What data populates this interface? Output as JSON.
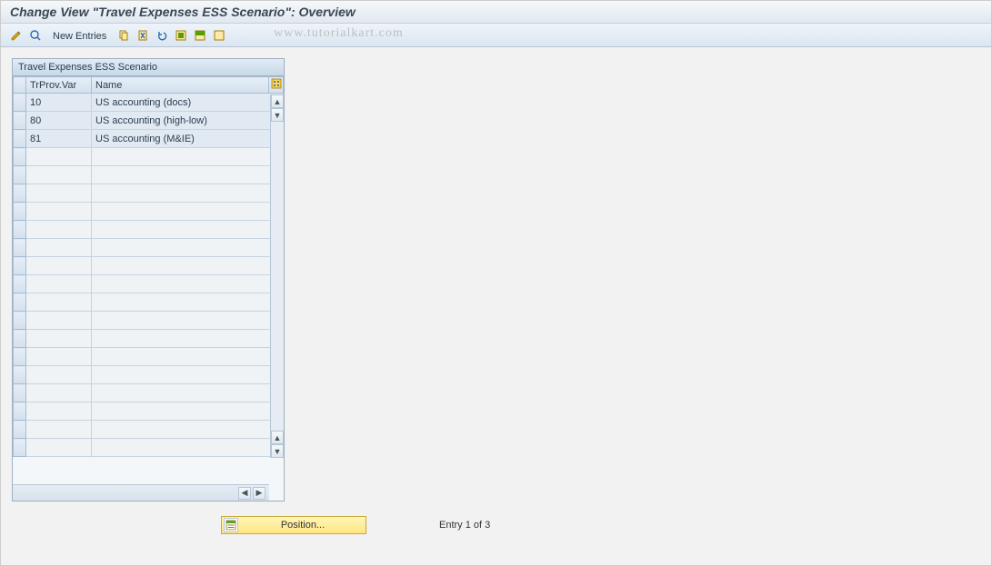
{
  "title": "Change View \"Travel Expenses ESS Scenario\": Overview",
  "watermark": "www.tutorialkart.com",
  "toolbar": {
    "new_entries": "New Entries"
  },
  "panel": {
    "title": "Travel Expenses ESS Scenario",
    "columns": {
      "trprov": "TrProv.Var",
      "name": "Name"
    },
    "rows": [
      {
        "trprov": "10",
        "name": "US accounting (docs)"
      },
      {
        "trprov": "80",
        "name": "US accounting (high-low)"
      },
      {
        "trprov": "81",
        "name": "US accounting (M&IE)"
      }
    ]
  },
  "footer": {
    "position_button": "Position...",
    "entry_label": "Entry 1 of 3"
  }
}
